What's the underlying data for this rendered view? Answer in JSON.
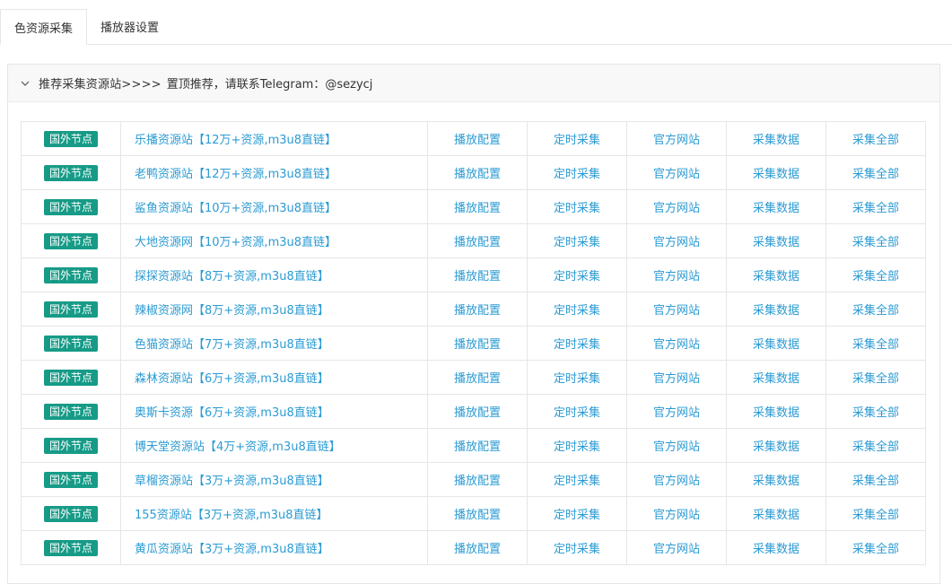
{
  "tabs": [
    {
      "label": "色资源采集",
      "active": true
    },
    {
      "label": "播放器设置",
      "active": false
    }
  ],
  "panel": {
    "title": "推荐采集资源站>>>>",
    "note": "置顶推荐，请联系Telegram：@sezycj"
  },
  "colors": {
    "badge": "#169b87",
    "link": "#2b9bd3",
    "border": "#e6e6e6"
  },
  "actions": [
    "播放配置",
    "定时采集",
    "官方网站",
    "采集数据",
    "采集全部"
  ],
  "rows": [
    {
      "node": "国外节点",
      "name": "乐播资源站【12万+资源,m3u8直链】"
    },
    {
      "node": "国外节点",
      "name": "老鸭资源站【12万+资源,m3u8直链】"
    },
    {
      "node": "国外节点",
      "name": "鲨鱼资源站【10万+资源,m3u8直链】"
    },
    {
      "node": "国外节点",
      "name": "大地资源网【10万+资源,m3u8直链】"
    },
    {
      "node": "国外节点",
      "name": "探探资源站【8万+资源,m3u8直链】"
    },
    {
      "node": "国外节点",
      "name": "辣椒资源网【8万+资源,m3u8直链】"
    },
    {
      "node": "国外节点",
      "name": "色猫资源站【7万+资源,m3u8直链】"
    },
    {
      "node": "国外节点",
      "name": "森林资源站【6万+资源,m3u8直链】"
    },
    {
      "node": "国外节点",
      "name": "奥斯卡资源【6万+资源,m3u8直链】"
    },
    {
      "node": "国外节点",
      "name": "博天堂资源站【4万+资源,m3u8直链】"
    },
    {
      "node": "国外节点",
      "name": "草榴资源站【3万+资源,m3u8直链】"
    },
    {
      "node": "国外节点",
      "name": "155资源站【3万+资源,m3u8直链】"
    },
    {
      "node": "国外节点",
      "name": "黄瓜资源站【3万+资源,m3u8直链】"
    }
  ]
}
